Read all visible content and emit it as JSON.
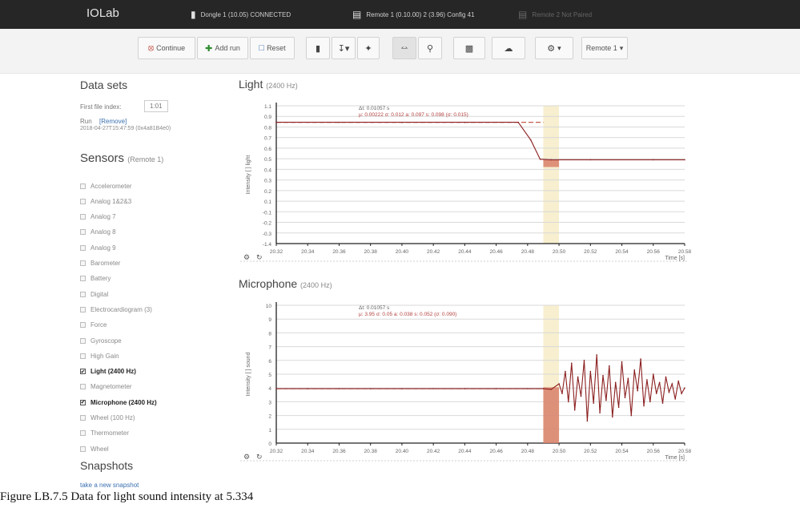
{
  "topbar": {
    "brand": "IOLab",
    "dongle": "Dongle 1 (10.05) CONNECTED",
    "remote1": "Remote 1 (0.10.00) 2 (3.96) Config 41",
    "remote2": "Remote 2 Not Paired"
  },
  "toolbar": {
    "continue": "Continue",
    "add": "Add run",
    "reset": "Reset",
    "remote_label": "Remote 1"
  },
  "sidebar": {
    "data_sets_title": "Data sets",
    "first_row_label": "First file index:",
    "first_row_value": "1:01",
    "run_label": "Run",
    "remove_link": "[Remove]",
    "run_id": "2018-04-27T15:47:59 (0x4a81B4e0)",
    "sensors_title": "Sensors",
    "sensors_remote": "(Remote 1)",
    "sensors": [
      {
        "label": "Accelerometer",
        "checked": false
      },
      {
        "label": "Analog 1&2&3",
        "checked": false
      },
      {
        "label": "Analog 7",
        "checked": false
      },
      {
        "label": "Analog 8",
        "checked": false
      },
      {
        "label": "Analog 9",
        "checked": false
      },
      {
        "label": "Barometer",
        "checked": false
      },
      {
        "label": "Battery",
        "checked": false
      },
      {
        "label": "Digital",
        "checked": false
      },
      {
        "label": "Electrocardiogram (3)",
        "checked": false
      },
      {
        "label": "Force",
        "checked": false
      },
      {
        "label": "Gyroscope",
        "checked": false
      },
      {
        "label": "High Gain",
        "checked": false
      },
      {
        "label": "Light (2400 Hz)",
        "checked": true
      },
      {
        "label": "Magnetometer",
        "checked": false
      },
      {
        "label": "Microphone (2400 Hz)",
        "checked": true
      },
      {
        "label": "Wheel (100 Hz)",
        "checked": false
      },
      {
        "label": "Thermometer",
        "checked": false
      },
      {
        "label": "Wheel",
        "checked": false
      }
    ],
    "snapshots_title": "Snapshots",
    "snapshot_link": "take a new snapshot"
  },
  "plots": [
    {
      "title": "Light",
      "rate": "(2400 Hz)",
      "ylabel": "Intensity [ ] light",
      "xlabel": "Time [s]",
      "yticks": [
        "1.1",
        "0.9",
        "0.8",
        "0.7",
        "0.6",
        "0.5",
        "0.4",
        "0.3",
        "0.2",
        "0.1",
        "-0.1",
        "-0.2",
        "-0.3",
        "-1.4"
      ],
      "readout1": "Δt: 0.01057 s",
      "readout2": "μ: 0.00222   σ: 0.012   a: 0.097   s: 0.098 (σ: 0.015)"
    },
    {
      "title": "Microphone",
      "rate": "(2400 Hz)",
      "ylabel": "Intensity [ ] sound",
      "xlabel": "Time [s]",
      "yticks": [
        "10",
        "9",
        "8",
        "7",
        "6",
        "5",
        "4",
        "3",
        "2",
        "1",
        "0"
      ],
      "readout1": "Δt: 0.01057 s",
      "readout2": "μ: 3.95   σ: 0.05   a: 0.038   s: 0.052 (σ: 0.090)"
    }
  ],
  "x_ticks": [
    "20.32",
    "20.34",
    "20.36",
    "20.38",
    "20.40",
    "20.42",
    "20.44",
    "20.46",
    "20.48",
    "20.50",
    "20.52",
    "20.54",
    "20.56",
    "20.58"
  ],
  "chart_data": [
    {
      "type": "line",
      "title": "Light (2400 Hz)",
      "xlabel": "Time [s]",
      "ylabel": "Intensity [ ] light",
      "xlim": [
        20.32,
        20.58
      ],
      "ylim": [
        -1.4,
        1.1
      ],
      "selection": [
        20.49,
        20.5
      ],
      "series": [
        {
          "values": [
            [
              20.32,
              0.8
            ],
            [
              20.36,
              0.8
            ],
            [
              20.4,
              0.8
            ],
            [
              20.44,
              0.8
            ],
            [
              20.474,
              0.8
            ],
            [
              20.482,
              0.48
            ],
            [
              20.488,
              0.13
            ],
            [
              20.495,
              0.12
            ],
            [
              20.52,
              0.12
            ],
            [
              20.56,
              0.12
            ],
            [
              20.58,
              0.12
            ]
          ]
        }
      ]
    },
    {
      "type": "line",
      "title": "Microphone (2400 Hz)",
      "xlabel": "Time [s]",
      "ylabel": "Intensity [ ] sound",
      "xlim": [
        20.32,
        20.58
      ],
      "ylim": [
        0,
        10
      ],
      "selection": [
        20.49,
        20.5
      ],
      "series": [
        {
          "values": [
            [
              20.32,
              3.95
            ],
            [
              20.34,
              3.95
            ],
            [
              20.36,
              3.95
            ],
            [
              20.38,
              3.95
            ],
            [
              20.4,
              3.95
            ],
            [
              20.42,
              3.95
            ],
            [
              20.44,
              3.95
            ],
            [
              20.46,
              3.95
            ],
            [
              20.48,
              3.95
            ],
            [
              20.49,
              3.95
            ],
            [
              20.495,
              3.9
            ],
            [
              20.5,
              4.3
            ],
            [
              20.502,
              3.6
            ],
            [
              20.504,
              5.2
            ],
            [
              20.506,
              3.0
            ],
            [
              20.508,
              5.8
            ],
            [
              20.51,
              2.4
            ],
            [
              20.512,
              4.8
            ],
            [
              20.514,
              3.4
            ],
            [
              20.516,
              6.0
            ],
            [
              20.518,
              1.6
            ],
            [
              20.52,
              5.2
            ],
            [
              20.522,
              2.9
            ],
            [
              20.524,
              6.4
            ],
            [
              20.526,
              2.2
            ],
            [
              20.528,
              4.9
            ],
            [
              20.53,
              3.1
            ],
            [
              20.532,
              5.6
            ],
            [
              20.534,
              1.9
            ],
            [
              20.536,
              4.4
            ],
            [
              20.538,
              2.6
            ],
            [
              20.54,
              5.9
            ],
            [
              20.542,
              3.3
            ],
            [
              20.544,
              4.7
            ],
            [
              20.546,
              2.0
            ],
            [
              20.548,
              5.3
            ],
            [
              20.55,
              3.8
            ],
            [
              20.552,
              6.1
            ],
            [
              20.554,
              2.7
            ],
            [
              20.556,
              4.6
            ],
            [
              20.558,
              3.0
            ],
            [
              20.56,
              5.0
            ],
            [
              20.562,
              3.6
            ],
            [
              20.564,
              4.4
            ],
            [
              20.566,
              2.9
            ],
            [
              20.568,
              4.8
            ],
            [
              20.57,
              3.7
            ],
            [
              20.572,
              4.3
            ],
            [
              20.574,
              3.2
            ],
            [
              20.576,
              4.5
            ],
            [
              20.578,
              3.6
            ],
            [
              20.58,
              4.0
            ]
          ]
        }
      ]
    }
  ],
  "caption": "Figure LB.7.5 Data for light sound intensity at 5.334"
}
